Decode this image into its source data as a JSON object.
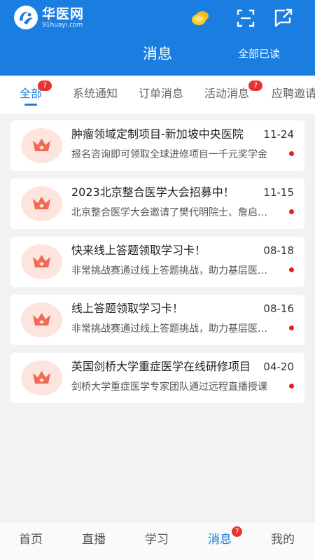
{
  "header": {
    "logo_cn": "华医网",
    "logo_en": "91huayi.com",
    "title": "消息",
    "mark_all_read": "全部已读",
    "icons": [
      "coin-icon",
      "scan-icon",
      "share-icon"
    ]
  },
  "tabs": [
    {
      "label": "全部",
      "badge": "7",
      "active": true
    },
    {
      "label": "系统通知",
      "badge": "",
      "active": false
    },
    {
      "label": "订单消息",
      "badge": "",
      "active": false
    },
    {
      "label": "活动消息",
      "badge": "7",
      "active": false
    },
    {
      "label": "应聘邀请",
      "badge": "",
      "active": false
    }
  ],
  "messages": [
    {
      "title": "肿瘤领域定制项目-新加坡中央医院",
      "date": "11-24",
      "summary": "报名咨询即可领取全球进修项目一千元奖学金",
      "unread": true
    },
    {
      "title": "2023北京整合医学大会招募中！",
      "date": "11-15",
      "summary": "北京整合医学大会邀请了樊代明院士、詹启敏院士",
      "unread": true
    },
    {
      "title": "快来线上答题领取学习卡！",
      "date": "08-18",
      "summary": "非常挑战赛通过线上答题挑战，助力基层医生学习",
      "unread": true
    },
    {
      "title": "线上答题领取学习卡！",
      "date": "08-16",
      "summary": "非常挑战赛通过线上答题挑战，助力基层医生学习",
      "unread": true
    },
    {
      "title": "英国剑桥大学重症医学在线研修项目",
      "date": "04-20",
      "summary": "剑桥大学重症医学专家团队通过远程直播授课",
      "unread": true
    }
  ],
  "bottom_nav": {
    "items": [
      {
        "label": "首页",
        "active": false
      },
      {
        "label": "直播",
        "active": false
      },
      {
        "label": "学习",
        "active": false
      },
      {
        "label": "消息",
        "active": true
      },
      {
        "label": "我的",
        "active": false
      }
    ],
    "message_badge": "7"
  },
  "colors": {
    "brand_blue": "#1a7de0",
    "badge_red": "#e8332d",
    "unread_dot": "#e61e1e",
    "avatar_bg": "#fde4de",
    "crown": "#ee6a53"
  }
}
